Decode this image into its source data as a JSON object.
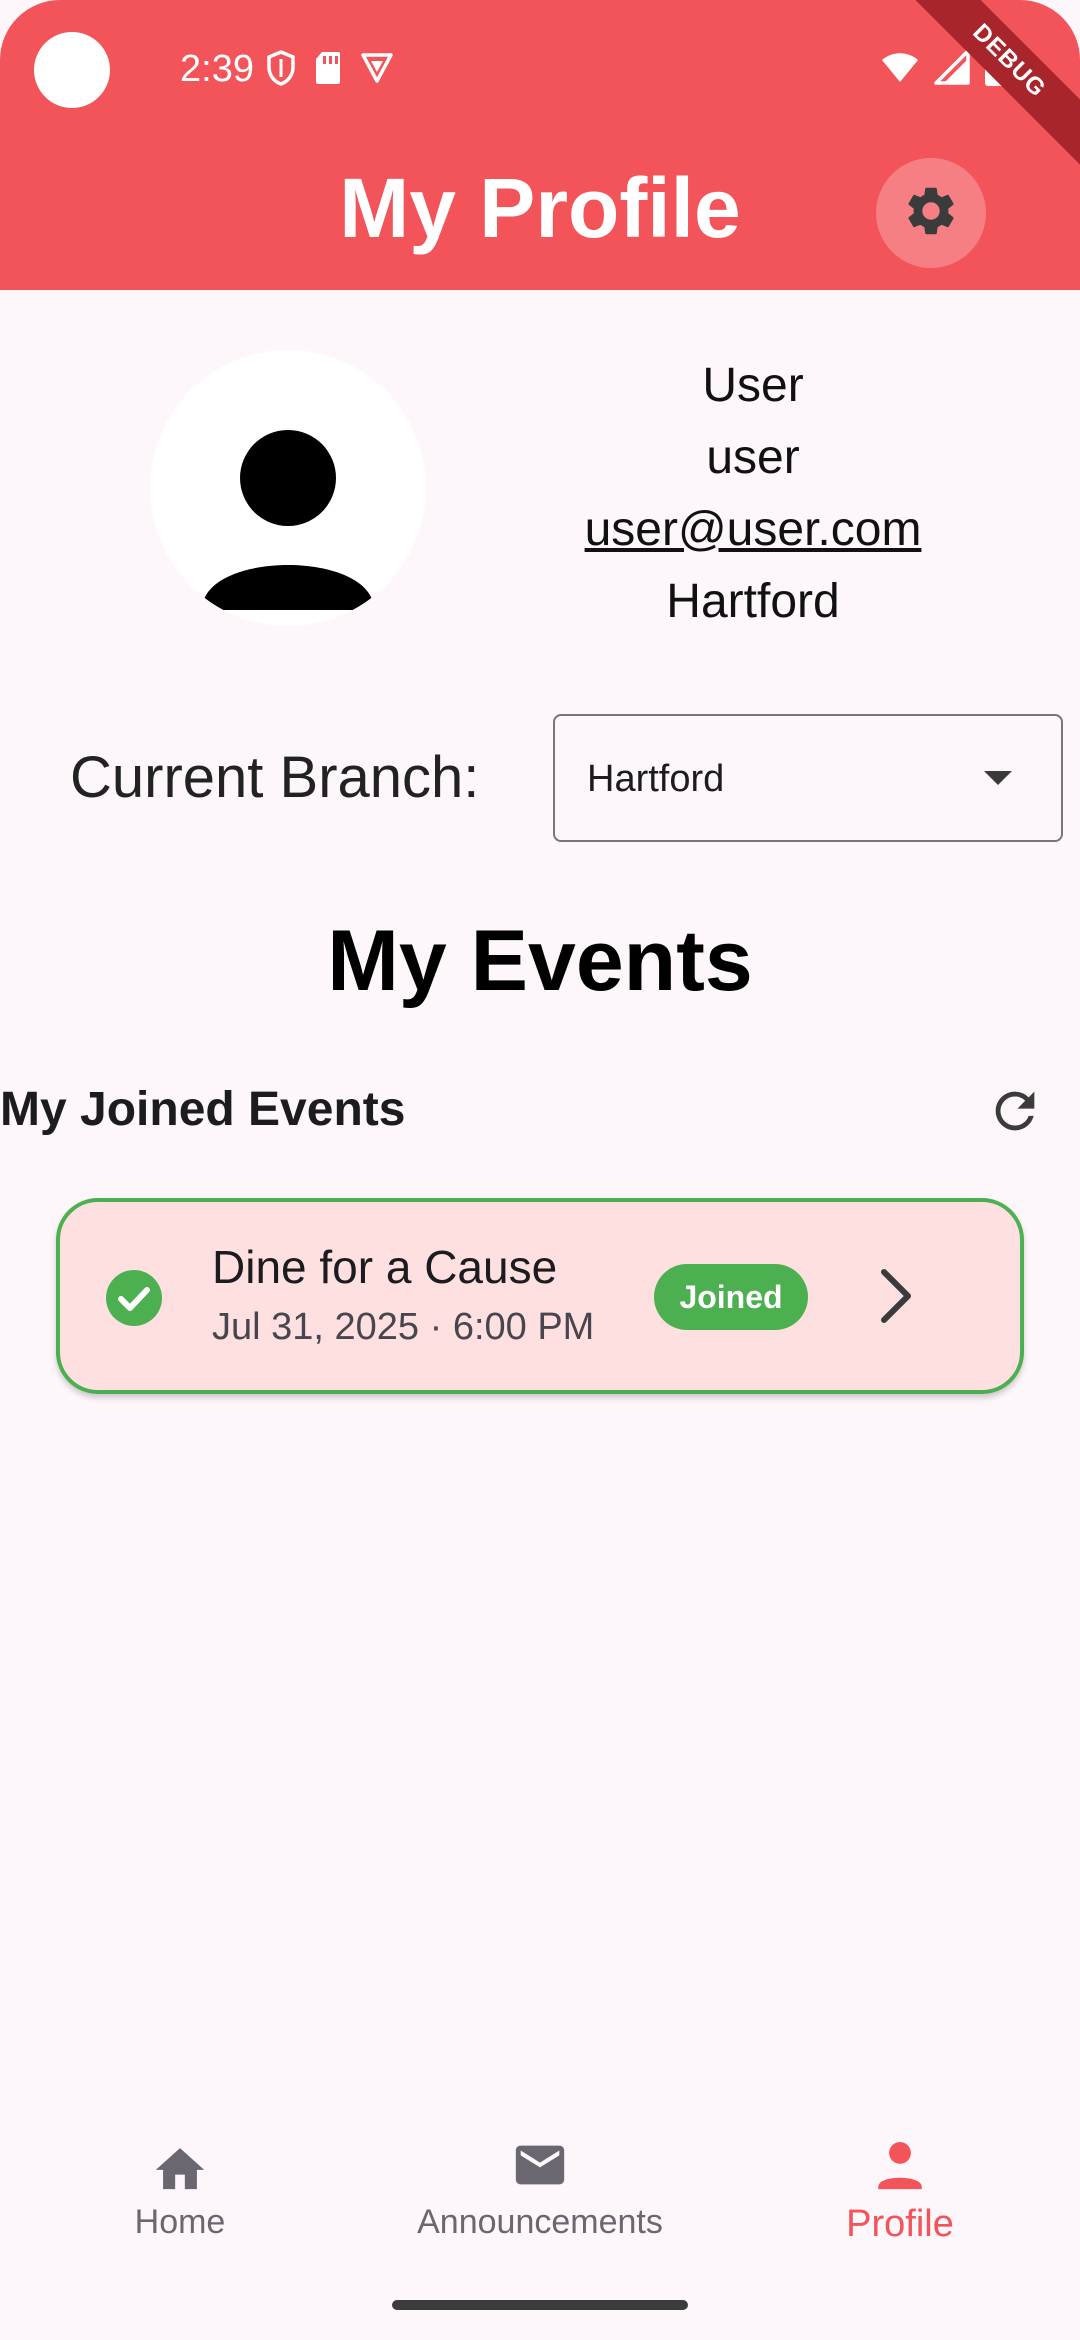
{
  "status_bar": {
    "time": "2:39",
    "icons_left": [
      "shield-icon",
      "sd-card-icon",
      "vpn-icon"
    ],
    "icons_right": [
      "wifi-icon",
      "signal-icon",
      "battery-icon"
    ],
    "debug_label": "DEBUG"
  },
  "header": {
    "title": "My Profile",
    "settings_icon": "gear-icon",
    "background_color": "#f25459"
  },
  "profile": {
    "avatar_icon": "person-icon",
    "display_name": "User",
    "username": "user",
    "email": "user@user.com",
    "location": "Hartford"
  },
  "branch": {
    "label": "Current Branch:",
    "selected": "Hartford"
  },
  "events": {
    "heading": "My Events",
    "joined_heading": "My Joined Events",
    "items": [
      {
        "title": "Dine for a Cause",
        "datetime": "Jul 31, 2025 · 6:00 PM",
        "status": "Joined",
        "status_color": "#4caf50"
      }
    ]
  },
  "bottom_nav": {
    "items": [
      {
        "label": "Home",
        "icon": "home-icon",
        "active": false
      },
      {
        "label": "Announcements",
        "icon": "mail-icon",
        "active": false
      },
      {
        "label": "Profile",
        "icon": "person-icon",
        "active": true
      }
    ],
    "active_color": "#f25459"
  }
}
